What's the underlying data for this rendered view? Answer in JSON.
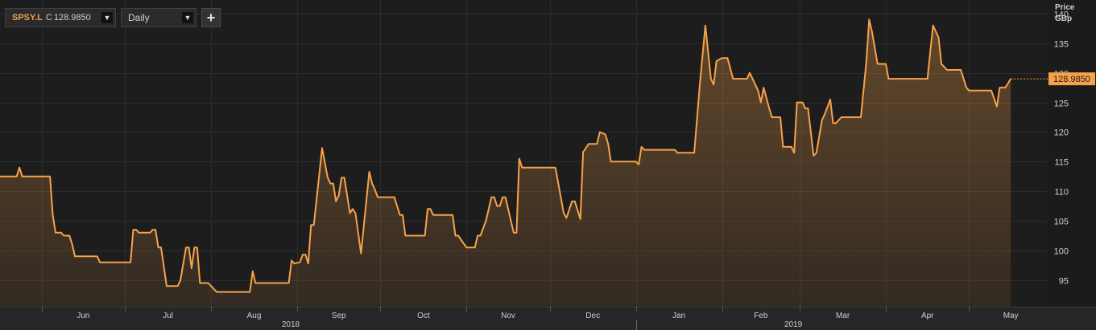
{
  "toolbar": {
    "ticker": "SPSY.L",
    "price_prefix": "C",
    "price": "128.9850",
    "dropdown_icon": "▼",
    "frequency": "Daily",
    "add_icon": "+"
  },
  "colors": {
    "background": "#1d1d1d",
    "grid": "#2c2c2c",
    "line": "#f7a24a",
    "axis_text": "#cfcfcf",
    "badge_bg": "#f7a24a"
  },
  "chart_data": {
    "type": "area",
    "ylabel": "Price",
    "yunit": "GBp",
    "ylim": [
      90.5,
      142.3
    ],
    "yticks": [
      95,
      100,
      105,
      110,
      115,
      120,
      125,
      130,
      135,
      140
    ],
    "xlim": [
      "2018-05-17",
      "2019-05-29"
    ],
    "month_labels": [
      {
        "label": "Jun",
        "date": "2018-06-01"
      },
      {
        "label": "Jul",
        "date": "2018-07-01"
      },
      {
        "label": "Aug",
        "date": "2018-08-01"
      },
      {
        "label": "Sep",
        "date": "2018-09-01"
      },
      {
        "label": "Oct",
        "date": "2018-10-01"
      },
      {
        "label": "Nov",
        "date": "2018-11-01"
      },
      {
        "label": "Dec",
        "date": "2018-12-01"
      },
      {
        "label": "Jan",
        "date": "2019-01-01"
      },
      {
        "label": "Feb",
        "date": "2019-02-01"
      },
      {
        "label": "Mar",
        "date": "2019-03-01"
      },
      {
        "label": "Apr",
        "date": "2019-04-01"
      },
      {
        "label": "May",
        "date": "2019-05-01"
      }
    ],
    "year_labels": [
      {
        "label": "2018",
        "date": "2018-09-01"
      },
      {
        "label": "2019",
        "date": "2019-03-01"
      }
    ],
    "last_value": "128.9850",
    "grid": true,
    "series": [
      {
        "values": [
          [
            "2018-05-17",
            112.5
          ],
          [
            "2018-05-23",
            112.5
          ],
          [
            "2018-05-24",
            114.0
          ],
          [
            "2018-05-25",
            112.5
          ],
          [
            "2018-06-04",
            112.5
          ],
          [
            "2018-06-05",
            106.0
          ],
          [
            "2018-06-06",
            103.0
          ],
          [
            "2018-06-08",
            103.0
          ],
          [
            "2018-06-09",
            102.5
          ],
          [
            "2018-06-11",
            102.5
          ],
          [
            "2018-06-12",
            101.0
          ],
          [
            "2018-06-13",
            99.0
          ],
          [
            "2018-06-21",
            99.0
          ],
          [
            "2018-06-22",
            98.0
          ],
          [
            "2018-07-03",
            98.0
          ],
          [
            "2018-07-04",
            103.5
          ],
          [
            "2018-07-05",
            103.5
          ],
          [
            "2018-07-06",
            103.0
          ],
          [
            "2018-07-10",
            103.0
          ],
          [
            "2018-07-11",
            103.5
          ],
          [
            "2018-07-12",
            103.5
          ],
          [
            "2018-07-13",
            100.5
          ],
          [
            "2018-07-14",
            100.5
          ],
          [
            "2018-07-16",
            94.0
          ],
          [
            "2018-07-20",
            94.0
          ],
          [
            "2018-07-21",
            95.0
          ],
          [
            "2018-07-23",
            100.5
          ],
          [
            "2018-07-24",
            100.5
          ],
          [
            "2018-07-25",
            97.0
          ],
          [
            "2018-07-26",
            100.5
          ],
          [
            "2018-07-27",
            100.5
          ],
          [
            "2018-07-28",
            94.5
          ],
          [
            "2018-07-31",
            94.5
          ],
          [
            "2018-08-03",
            93.0
          ],
          [
            "2018-08-15",
            93.0
          ],
          [
            "2018-08-16",
            96.5
          ],
          [
            "2018-08-17",
            94.5
          ],
          [
            "2018-08-29",
            94.5
          ],
          [
            "2018-08-30",
            98.3
          ],
          [
            "2018-08-31",
            97.8
          ],
          [
            "2018-09-02",
            98.0
          ],
          [
            "2018-09-03",
            99.3
          ],
          [
            "2018-09-04",
            99.3
          ],
          [
            "2018-09-05",
            97.8
          ],
          [
            "2018-09-06",
            104.3
          ],
          [
            "2018-09-07",
            104.3
          ],
          [
            "2018-09-10",
            117.3
          ],
          [
            "2018-09-12",
            112.3
          ],
          [
            "2018-09-13",
            111.3
          ],
          [
            "2018-09-14",
            111.3
          ],
          [
            "2018-09-15",
            108.3
          ],
          [
            "2018-09-16",
            109.3
          ],
          [
            "2018-09-17",
            112.3
          ],
          [
            "2018-09-18",
            112.3
          ],
          [
            "2018-09-20",
            106.3
          ],
          [
            "2018-09-21",
            107.0
          ],
          [
            "2018-09-22",
            106.3
          ],
          [
            "2018-09-24",
            99.5
          ],
          [
            "2018-09-27",
            113.3
          ],
          [
            "2018-09-28",
            111.3
          ],
          [
            "2018-09-29",
            110.3
          ],
          [
            "2018-09-30",
            109.0
          ],
          [
            "2018-10-06",
            109.0
          ],
          [
            "2018-10-07",
            107.5
          ],
          [
            "2018-10-08",
            106.0
          ],
          [
            "2018-10-09",
            106.0
          ],
          [
            "2018-10-10",
            102.5
          ],
          [
            "2018-10-17",
            102.5
          ],
          [
            "2018-10-18",
            107.0
          ],
          [
            "2018-10-19",
            107.0
          ],
          [
            "2018-10-20",
            106.0
          ],
          [
            "2018-10-27",
            106.0
          ],
          [
            "2018-10-28",
            102.5
          ],
          [
            "2018-10-29",
            102.5
          ],
          [
            "2018-11-01",
            100.5
          ],
          [
            "2018-11-04",
            100.5
          ],
          [
            "2018-11-05",
            102.5
          ],
          [
            "2018-11-06",
            102.5
          ],
          [
            "2018-11-08",
            105.0
          ],
          [
            "2018-11-10",
            109.0
          ],
          [
            "2018-11-11",
            109.0
          ],
          [
            "2018-11-12",
            107.5
          ],
          [
            "2018-11-13",
            107.5
          ],
          [
            "2018-11-14",
            109.0
          ],
          [
            "2018-11-15",
            109.0
          ],
          [
            "2018-11-18",
            103.0
          ],
          [
            "2018-11-19",
            103.0
          ],
          [
            "2018-11-20",
            115.5
          ],
          [
            "2018-11-21",
            114.0
          ],
          [
            "2018-12-03",
            114.0
          ],
          [
            "2018-12-06",
            106.3
          ],
          [
            "2018-12-07",
            105.5
          ],
          [
            "2018-12-09",
            108.3
          ],
          [
            "2018-12-10",
            108.3
          ],
          [
            "2018-12-12",
            105.3
          ],
          [
            "2018-12-13",
            116.6
          ],
          [
            "2018-12-15",
            118.0
          ],
          [
            "2018-12-18",
            118.0
          ],
          [
            "2018-12-19",
            120.0
          ],
          [
            "2018-12-21",
            119.6
          ],
          [
            "2018-12-22",
            118.0
          ],
          [
            "2018-12-23",
            115.0
          ],
          [
            "2018-12-25",
            115.0
          ],
          [
            "2019-01-01",
            115.0
          ],
          [
            "2019-01-02",
            114.5
          ],
          [
            "2019-01-03",
            117.5
          ],
          [
            "2019-01-04",
            117.0
          ],
          [
            "2019-01-15",
            117.0
          ],
          [
            "2019-01-16",
            116.5
          ],
          [
            "2019-01-22",
            116.5
          ],
          [
            "2019-01-24",
            128.0
          ],
          [
            "2019-01-26",
            138.0
          ],
          [
            "2019-01-28",
            129.0
          ],
          [
            "2019-01-29",
            128.0
          ],
          [
            "2019-01-30",
            132.0
          ],
          [
            "2019-02-01",
            132.5
          ],
          [
            "2019-02-03",
            132.5
          ],
          [
            "2019-02-05",
            129.0
          ],
          [
            "2019-02-10",
            129.0
          ],
          [
            "2019-02-11",
            130.0
          ],
          [
            "2019-02-14",
            127.0
          ],
          [
            "2019-02-15",
            125.0
          ],
          [
            "2019-02-16",
            127.5
          ],
          [
            "2019-02-18",
            124.0
          ],
          [
            "2019-02-19",
            122.5
          ],
          [
            "2019-02-22",
            122.5
          ],
          [
            "2019-02-23",
            117.5
          ],
          [
            "2019-02-26",
            117.5
          ],
          [
            "2019-02-27",
            116.5
          ],
          [
            "2019-02-28",
            125.0
          ],
          [
            "2019-03-02",
            125.0
          ],
          [
            "2019-03-03",
            124.0
          ],
          [
            "2019-03-04",
            124.0
          ],
          [
            "2019-03-06",
            116.0
          ],
          [
            "2019-03-07",
            116.5
          ],
          [
            "2019-03-09",
            122.0
          ],
          [
            "2019-03-10",
            123.0
          ],
          [
            "2019-03-12",
            125.5
          ],
          [
            "2019-03-13",
            121.5
          ],
          [
            "2019-03-14",
            121.5
          ],
          [
            "2019-03-16",
            122.5
          ],
          [
            "2019-03-23",
            122.5
          ],
          [
            "2019-03-25",
            132.0
          ],
          [
            "2019-03-26",
            139.0
          ],
          [
            "2019-03-27",
            137.0
          ],
          [
            "2019-03-29",
            131.5
          ],
          [
            "2019-03-31",
            131.5
          ],
          [
            "2019-04-01",
            131.5
          ],
          [
            "2019-04-02",
            129.0
          ],
          [
            "2019-04-16",
            129.0
          ],
          [
            "2019-04-18",
            138.0
          ],
          [
            "2019-04-20",
            136.0
          ],
          [
            "2019-04-21",
            131.5
          ],
          [
            "2019-04-23",
            130.5
          ],
          [
            "2019-04-28",
            130.5
          ],
          [
            "2019-04-30",
            127.5
          ],
          [
            "2019-05-01",
            127.0
          ],
          [
            "2019-05-09",
            127.0
          ],
          [
            "2019-05-11",
            124.3
          ],
          [
            "2019-05-12",
            127.5
          ],
          [
            "2019-05-14",
            127.5
          ],
          [
            "2019-05-16",
            129.0
          ]
        ]
      }
    ]
  }
}
